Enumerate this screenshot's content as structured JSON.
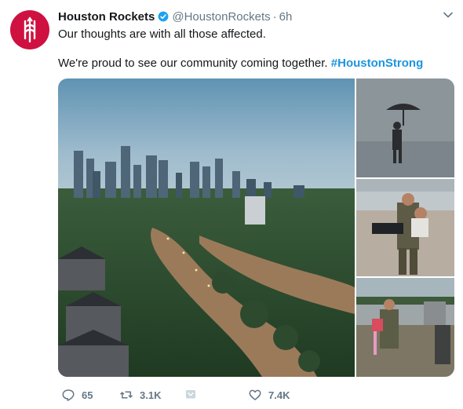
{
  "tweet": {
    "author_name": "Houston Rockets",
    "handle": "@HoustonRockets",
    "separator": "·",
    "time": "6h",
    "line1": "Our thoughts are with all those affected.",
    "line2_text": "We're proud to see our community coming together. ",
    "hashtag": "#HoustonStrong",
    "media": [
      {
        "icon": "flooded-city-aerial-photo"
      },
      {
        "icon": "person-with-umbrella-photo"
      },
      {
        "icon": "rescuer-carrying-woman-photo"
      },
      {
        "icon": "rescuer-carrying-child-photo"
      }
    ]
  },
  "actions": {
    "reply_count": "65",
    "retweet_count": "3.1K",
    "like_count": "7.4K"
  },
  "colors": {
    "brand_red": "#ce1141",
    "link_blue": "#1b95e0",
    "verified_blue": "#1da1f2",
    "muted_gray": "#657786"
  },
  "icons": [
    "rockets-logo-icon",
    "verified-badge-icon",
    "chevron-down-icon",
    "reply-icon",
    "retweet-icon",
    "direct-message-icon",
    "heart-icon"
  ]
}
